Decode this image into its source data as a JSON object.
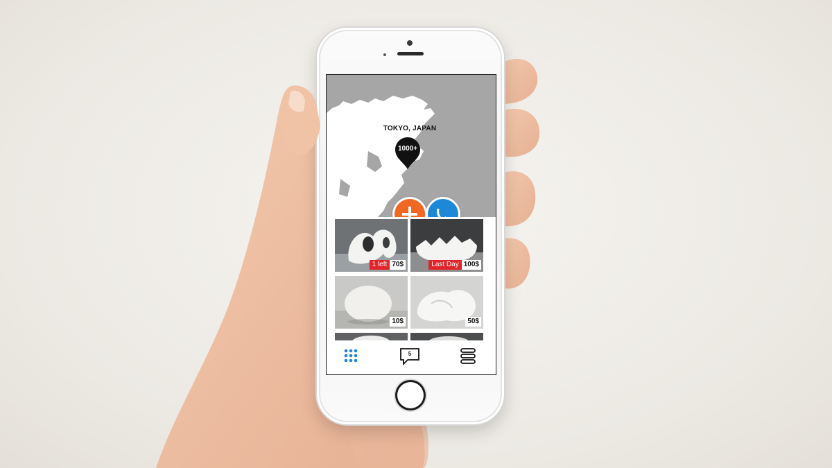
{
  "map": {
    "location": "TOKYO, JAPAN",
    "pin_count": "1000+"
  },
  "actions": {
    "add_icon": "plus-icon",
    "share_icon": "share-arrow-icon",
    "add_color": "#f26722",
    "share_color": "#1d87d8"
  },
  "items": [
    {
      "tag": "1 left",
      "price": "70$"
    },
    {
      "tag": "Last Day",
      "price": "100$"
    },
    {
      "tag": "",
      "price": "10$"
    },
    {
      "tag": "",
      "price": "50$"
    }
  ],
  "tabbar": {
    "grid_icon": "grid-dots-icon",
    "messages_icon": "chat-bubble-icon",
    "messages_count": "5",
    "menu_icon": "stack-menu-icon",
    "accent": "#1d87d8"
  }
}
